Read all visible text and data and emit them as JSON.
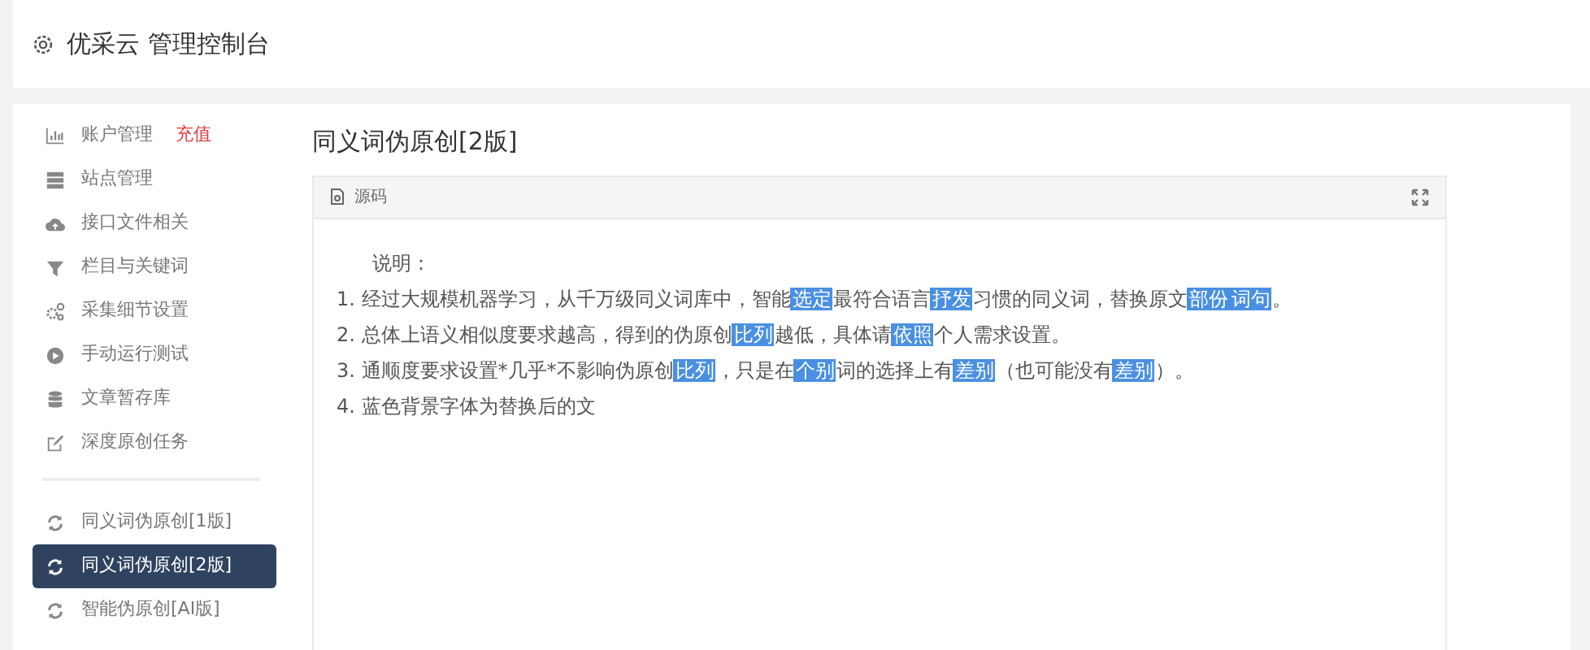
{
  "header": {
    "title": "优采云 管理控制台"
  },
  "sidebar": {
    "groups": [
      {
        "items": [
          {
            "label": "账户管理",
            "tag": "充值",
            "selected": false
          },
          {
            "label": "站点管理",
            "selected": false
          },
          {
            "label": "接口文件相关",
            "selected": false
          },
          {
            "label": "栏目与关键词",
            "selected": false
          },
          {
            "label": "采集细节设置",
            "selected": false
          },
          {
            "label": "手动运行测试",
            "selected": false
          },
          {
            "label": "文章暂存库",
            "selected": false
          },
          {
            "label": "深度原创任务",
            "selected": false
          }
        ]
      },
      {
        "items": [
          {
            "label": "同义词伪原创[1版]",
            "selected": false
          },
          {
            "label": "同义词伪原创[2版]",
            "selected": true
          },
          {
            "label": "智能伪原创[AI版]",
            "selected": false
          }
        ]
      }
    ]
  },
  "main": {
    "heading": "同义词伪原创[2版]",
    "panel": {
      "title": "源码",
      "intro": "说明：",
      "lines": [
        [
          {
            "text": "1. 经过大规模机器学习，从千万级同义词库中，智能",
            "highlighted": false
          },
          {
            "text": "选定",
            "highlighted": true
          },
          {
            "text": "最符合语言",
            "highlighted": false
          },
          {
            "text": "抒发",
            "highlighted": true
          },
          {
            "text": "习惯的同义词，替换原文",
            "highlighted": false
          },
          {
            "text": "部份",
            "highlighted": true
          },
          {
            "text": "词句",
            "highlighted": true
          },
          {
            "text": "。",
            "highlighted": false
          }
        ],
        [
          {
            "text": "2. 总体上语义相似度要求越高，得到的伪原创",
            "highlighted": false
          },
          {
            "text": "比列",
            "highlighted": true
          },
          {
            "text": "越低，具体请",
            "highlighted": false
          },
          {
            "text": "依照",
            "highlighted": true
          },
          {
            "text": "个人需求设置。",
            "highlighted": false
          }
        ],
        [
          {
            "text": "3. 通顺度要求设置*几乎*不影响伪原创",
            "highlighted": false
          },
          {
            "text": "比列",
            "highlighted": true
          },
          {
            "text": "，只是在",
            "highlighted": false
          },
          {
            "text": "个别",
            "highlighted": true
          },
          {
            "text": "词的选择上有",
            "highlighted": false
          },
          {
            "text": "差别",
            "highlighted": true
          },
          {
            "text": "（也可能没有",
            "highlighted": false
          },
          {
            "text": "差别",
            "highlighted": true
          },
          {
            "text": "）。",
            "highlighted": false
          }
        ],
        [
          {
            "text": "4. 蓝色背景字体为替换后的文",
            "highlighted": false
          }
        ]
      ]
    }
  }
}
